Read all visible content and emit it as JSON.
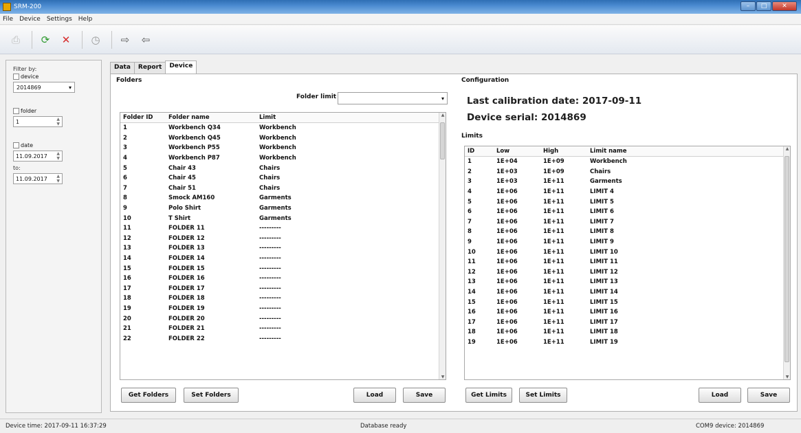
{
  "window": {
    "title": "SRM-200",
    "buttons": [
      "–",
      "□",
      "✕"
    ]
  },
  "menu": [
    "File",
    "Device",
    "Settings",
    "Help"
  ],
  "toolbar": {
    "icons": [
      "print-icon",
      "refresh-icon",
      "delete-icon",
      "clock-icon",
      "import-icon",
      "export-icon"
    ]
  },
  "filter": {
    "title": "Filter by:",
    "device_label": "device",
    "device_value": "2014869",
    "folder_label": "folder",
    "folder_value": "1",
    "date_label": "date",
    "date_from": "11.09.2017",
    "to_label": "to:",
    "date_to": "11.09.2017"
  },
  "tabs": [
    "Data",
    "Report",
    "Device"
  ],
  "active_tab": "Device",
  "folders": {
    "title": "Folders",
    "folder_limit_label": "Folder limit",
    "folder_limit_value": "",
    "columns": [
      "Folder ID",
      "Folder name",
      "Limit"
    ],
    "rows": [
      [
        "1",
        "Workbench Q34",
        "Workbench"
      ],
      [
        "2",
        "Workbench Q45",
        "Workbench"
      ],
      [
        "3",
        "Workbench P55",
        "Workbench"
      ],
      [
        "4",
        "Workbench P87",
        "Workbench"
      ],
      [
        "5",
        "Chair 43",
        "Chairs"
      ],
      [
        "6",
        "Chair 45",
        "Chairs"
      ],
      [
        "7",
        "Chair 51",
        "Chairs"
      ],
      [
        "8",
        "Smock AM160",
        "Garments"
      ],
      [
        "9",
        "Polo Shirt",
        "Garments"
      ],
      [
        "10",
        "T Shirt",
        "Garments"
      ],
      [
        "11",
        "FOLDER 11",
        "---------"
      ],
      [
        "12",
        "FOLDER 12",
        "---------"
      ],
      [
        "13",
        "FOLDER 13",
        "---------"
      ],
      [
        "14",
        "FOLDER 14",
        "---------"
      ],
      [
        "15",
        "FOLDER 15",
        "---------"
      ],
      [
        "16",
        "FOLDER 16",
        "---------"
      ],
      [
        "17",
        "FOLDER 17",
        "---------"
      ],
      [
        "18",
        "FOLDER 18",
        "---------"
      ],
      [
        "19",
        "FOLDER 19",
        "---------"
      ],
      [
        "20",
        "FOLDER 20",
        "---------"
      ],
      [
        "21",
        "FOLDER 21",
        "---------"
      ],
      [
        "22",
        "FOLDER 22",
        "---------"
      ]
    ],
    "buttons": {
      "get": "Get Folders",
      "set": "Set Folders",
      "load": "Load",
      "save": "Save"
    }
  },
  "configuration": {
    "title": "Configuration",
    "calibration": "Last calibration date: 2017-09-11",
    "serial": "Device serial: 2014869"
  },
  "limits": {
    "title": "Limits",
    "columns": [
      "ID",
      "Low",
      "High",
      "Limit name"
    ],
    "rows": [
      [
        "1",
        "1E+04",
        "1E+09",
        "Workbench"
      ],
      [
        "2",
        "1E+03",
        "1E+09",
        "Chairs"
      ],
      [
        "3",
        "1E+03",
        "1E+11",
        "Garments"
      ],
      [
        "4",
        "1E+06",
        "1E+11",
        "LIMIT 4"
      ],
      [
        "5",
        "1E+06",
        "1E+11",
        "LIMIT 5"
      ],
      [
        "6",
        "1E+06",
        "1E+11",
        "LIMIT 6"
      ],
      [
        "7",
        "1E+06",
        "1E+11",
        "LIMIT 7"
      ],
      [
        "8",
        "1E+06",
        "1E+11",
        "LIMIT 8"
      ],
      [
        "9",
        "1E+06",
        "1E+11",
        "LIMIT 9"
      ],
      [
        "10",
        "1E+06",
        "1E+11",
        "LIMIT 10"
      ],
      [
        "11",
        "1E+06",
        "1E+11",
        "LIMIT 11"
      ],
      [
        "12",
        "1E+06",
        "1E+11",
        "LIMIT 12"
      ],
      [
        "13",
        "1E+06",
        "1E+11",
        "LIMIT 13"
      ],
      [
        "14",
        "1E+06",
        "1E+11",
        "LIMIT 14"
      ],
      [
        "15",
        "1E+06",
        "1E+11",
        "LIMIT 15"
      ],
      [
        "16",
        "1E+06",
        "1E+11",
        "LIMIT 16"
      ],
      [
        "17",
        "1E+06",
        "1E+11",
        "LIMIT 17"
      ],
      [
        "18",
        "1E+06",
        "1E+11",
        "LIMIT 18"
      ],
      [
        "19",
        "1E+06",
        "1E+11",
        "LIMIT 19"
      ]
    ],
    "buttons": {
      "get": "Get Limits",
      "set": "Set Limits",
      "load": "Load",
      "save": "Save"
    }
  },
  "status": {
    "device_time": "Device time: 2017-09-11 16:37:29",
    "db_status": "Database ready",
    "com": "COM9 device: 2014869"
  }
}
